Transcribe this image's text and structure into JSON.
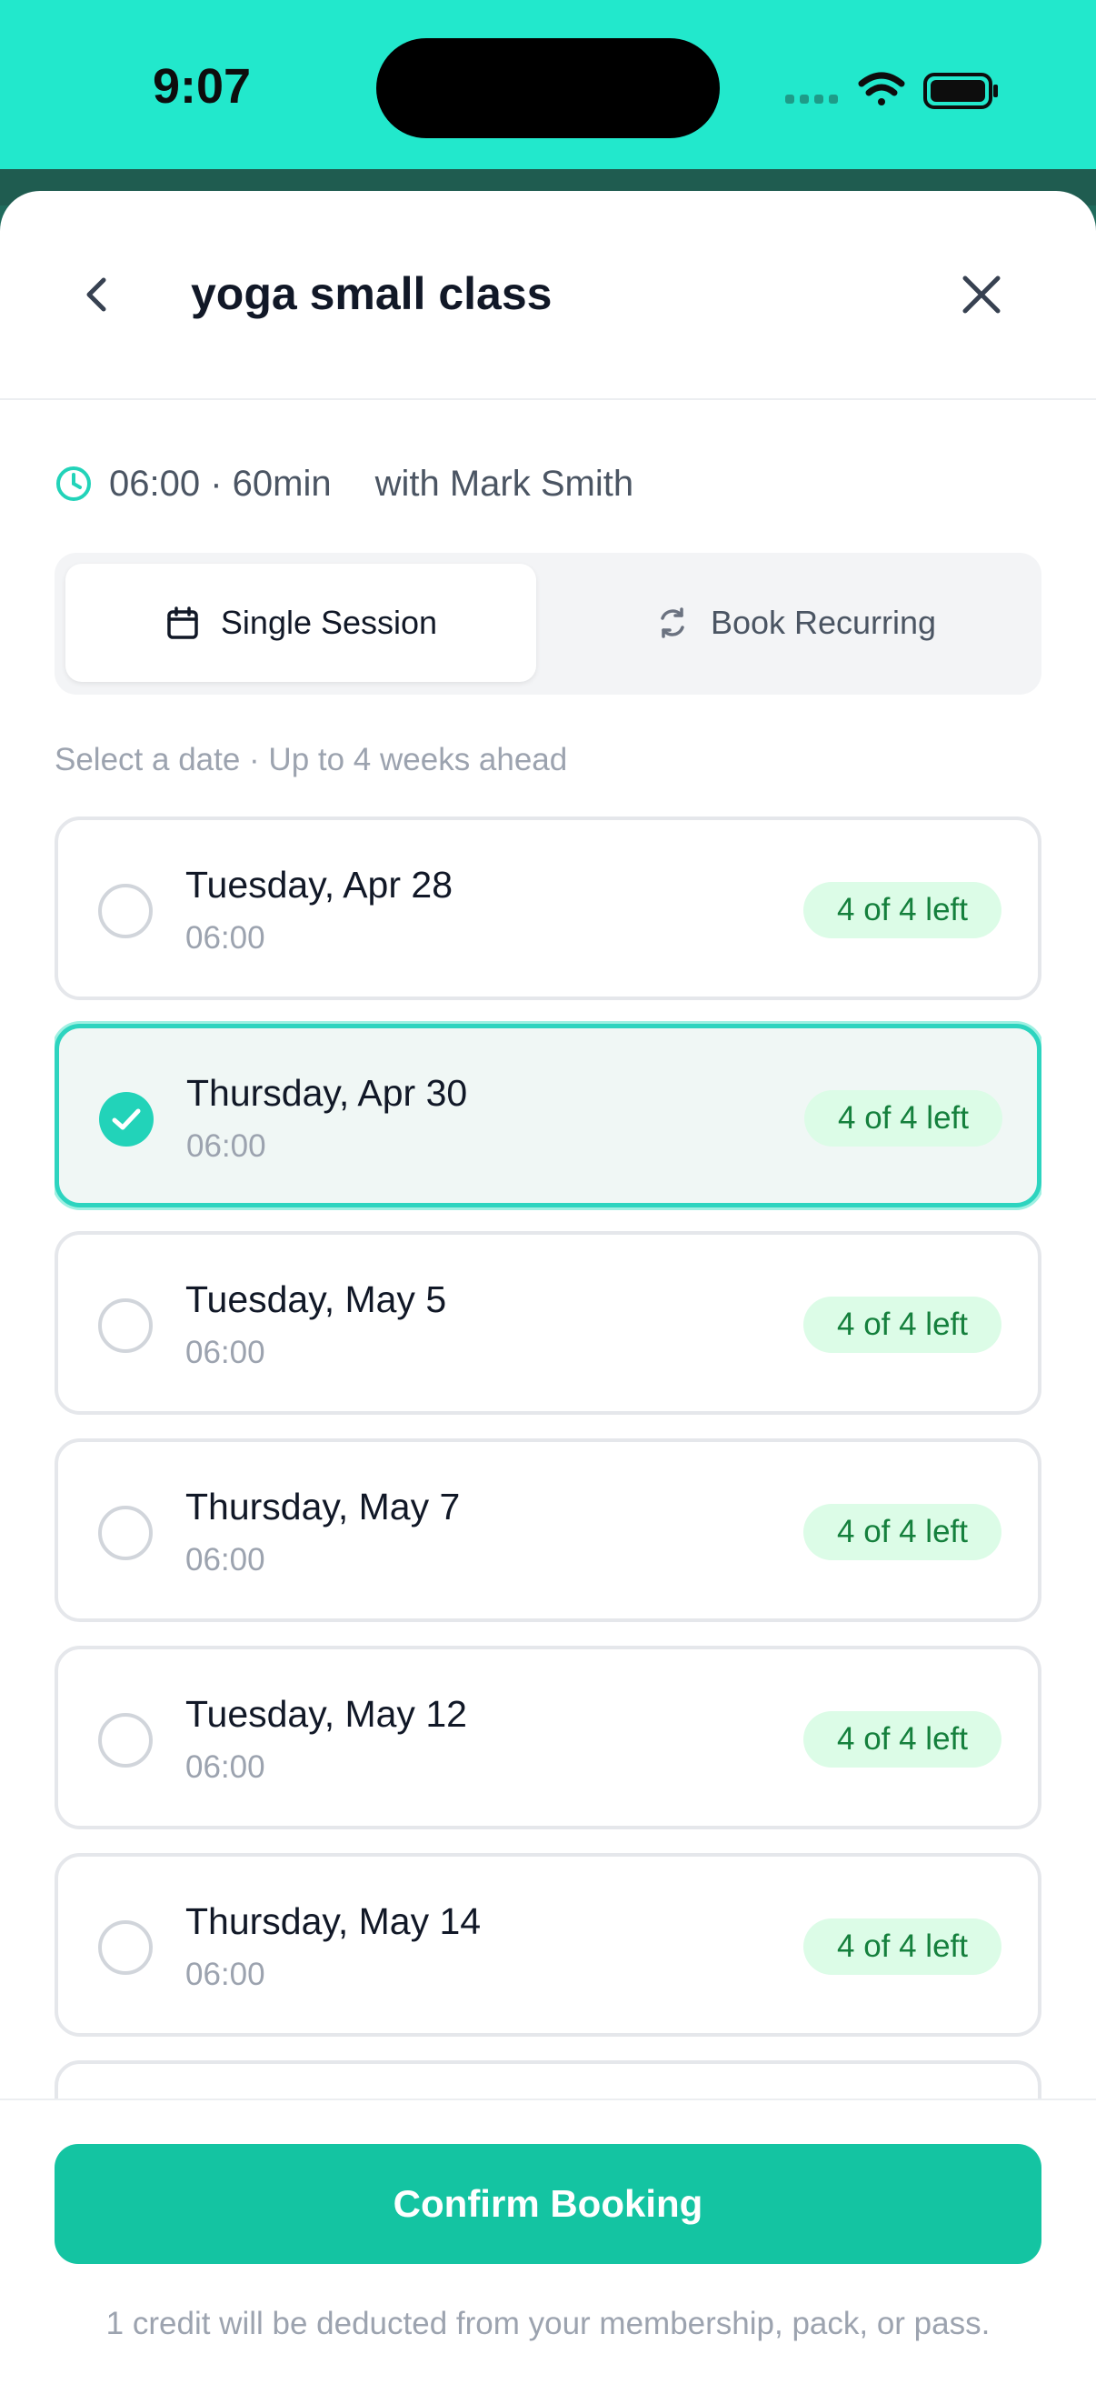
{
  "status": {
    "time": "9:07"
  },
  "header": {
    "title": "yoga small class"
  },
  "meta": {
    "schedule": "06:00 · 60min",
    "instructor": "with Mark Smith"
  },
  "tabs": [
    {
      "label": "Single Session",
      "active": true
    },
    {
      "label": "Book Recurring",
      "active": false
    }
  ],
  "hint": "Select a date · Up to 4 weeks ahead",
  "sessions": [
    {
      "date": "Tuesday, Apr 28",
      "time": "06:00",
      "availability": "4 of 4 left",
      "selected": false
    },
    {
      "date": "Thursday, Apr 30",
      "time": "06:00",
      "availability": "4 of 4 left",
      "selected": true
    },
    {
      "date": "Tuesday, May 5",
      "time": "06:00",
      "availability": "4 of 4 left",
      "selected": false
    },
    {
      "date": "Thursday, May 7",
      "time": "06:00",
      "availability": "4 of 4 left",
      "selected": false
    },
    {
      "date": "Tuesday, May 12",
      "time": "06:00",
      "availability": "4 of 4 left",
      "selected": false
    },
    {
      "date": "Thursday, May 14",
      "time": "06:00",
      "availability": "4 of 4 left",
      "selected": false
    },
    {
      "date": "",
      "time": "",
      "availability": "",
      "selected": false
    }
  ],
  "footer": {
    "confirm_label": "Confirm Booking",
    "note": "1 credit will be deducted from your membership, pack, or pass."
  },
  "colors": {
    "accent": "#22d3b9",
    "button": "#14c4a2",
    "status_bar": "#22e8cc",
    "badge_text": "#15803d",
    "badge_bg": "#dcfce7"
  },
  "icons": {
    "back": "chevron-left-icon",
    "close": "close-icon",
    "clock": "clock-icon",
    "calendar": "calendar-icon",
    "repeat": "repeat-icon",
    "check": "check-icon"
  }
}
